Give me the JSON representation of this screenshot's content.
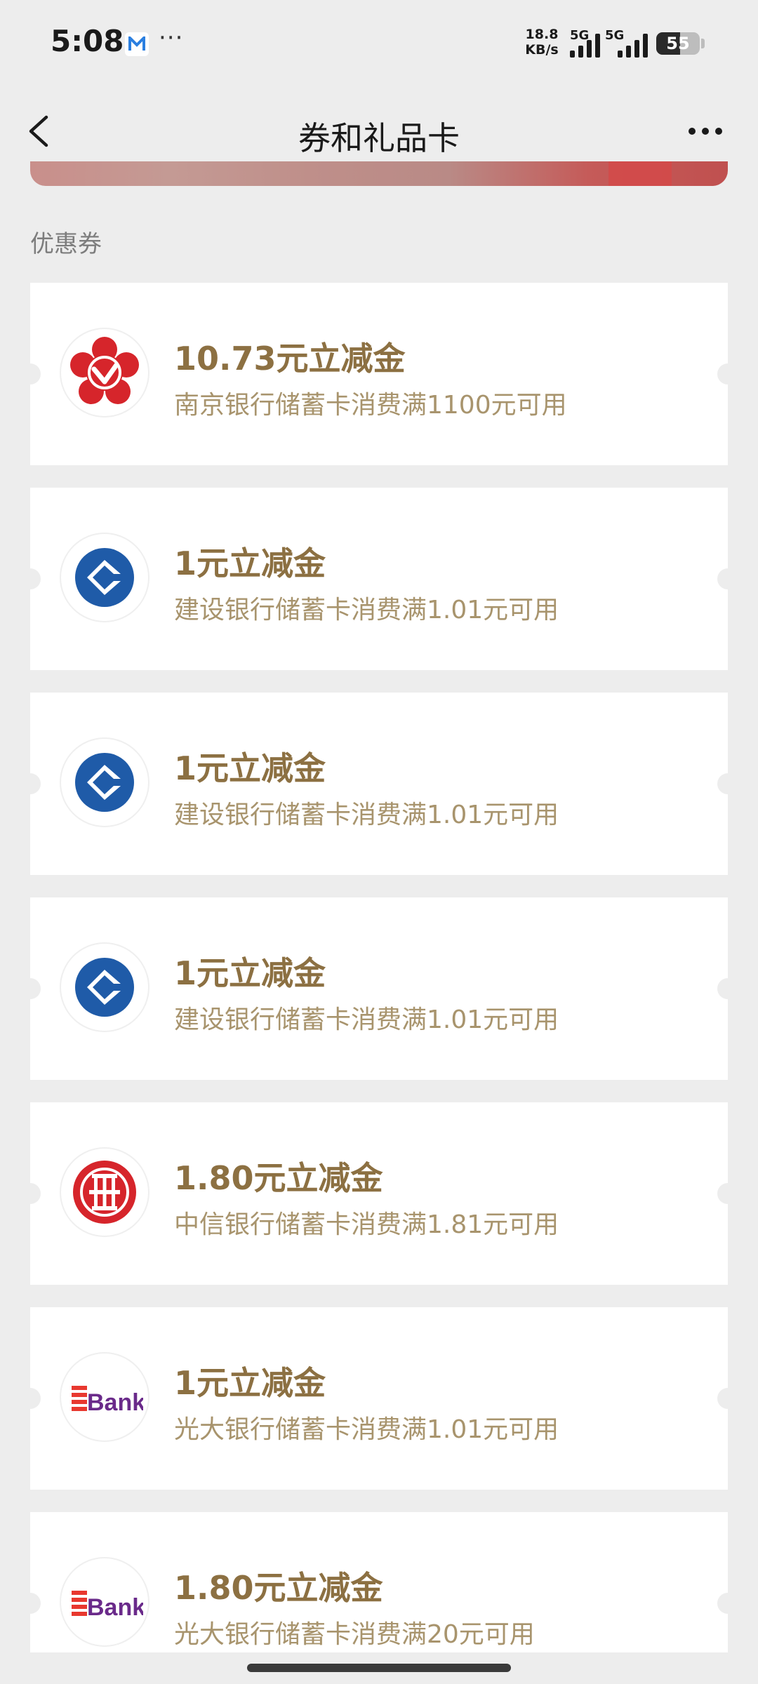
{
  "status_bar": {
    "time": "5:08",
    "more": "···",
    "net_speed_value": "18.8",
    "net_speed_unit": "KB/s",
    "sim1_label": "5G",
    "sim2_label": "5G",
    "battery": "55",
    "battery_level": 0.55
  },
  "nav": {
    "title": "券和礼品卡"
  },
  "section": {
    "label": "优惠券"
  },
  "coupons": [
    {
      "title": "10.73元立减金",
      "desc": "南京银行储蓄卡消费满1100元可用",
      "bank_icon": "nanjing-bank-icon"
    },
    {
      "title": "1元立减金",
      "desc": "建设银行储蓄卡消费满1.01元可用",
      "bank_icon": "ccb-bank-icon"
    },
    {
      "title": "1元立减金",
      "desc": "建设银行储蓄卡消费满1.01元可用",
      "bank_icon": "ccb-bank-icon"
    },
    {
      "title": "1元立减金",
      "desc": "建设银行储蓄卡消费满1.01元可用",
      "bank_icon": "ccb-bank-icon"
    },
    {
      "title": "1.80元立减金",
      "desc": "中信银行储蓄卡消费满1.81元可用",
      "bank_icon": "citic-bank-icon"
    },
    {
      "title": "1元立减金",
      "desc": "光大银行储蓄卡消费满1.01元可用",
      "bank_icon": "ceb-bank-icon",
      "logo_text": "Bank"
    },
    {
      "title": "1.80元立减金",
      "desc": "光大银行储蓄卡消费满20元可用",
      "bank_icon": "ceb-bank-icon",
      "logo_text": "Bank"
    }
  ],
  "colors": {
    "background": "#ededed",
    "coupon_title": "#8c7042",
    "coupon_desc": "#a8946d",
    "ccb_blue": "#1f5ba8",
    "red": "#d6252b"
  }
}
